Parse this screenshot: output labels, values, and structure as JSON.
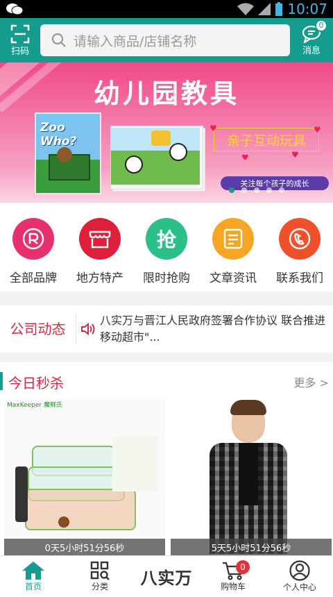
{
  "status_bar": {
    "time": "10:07"
  },
  "header": {
    "scan_label": "扫码",
    "search": {
      "placeholder": "请输入商品/店铺名称"
    },
    "messages": {
      "label": "消息",
      "badge": "0"
    }
  },
  "banner": {
    "title": "幼儿园教具",
    "book_logo": "Zoo Who?",
    "tagline": "亲子互动玩具",
    "subline": "关注每个孩子的成长",
    "slide_count": 5,
    "active_slide": 1
  },
  "shortcuts": [
    {
      "label": "全部品牌",
      "icon": "registered-icon",
      "color": "#e8306e",
      "glyph": "®"
    },
    {
      "label": "地方特产",
      "icon": "store-icon",
      "color": "#e0203a",
      "glyph": "⌂"
    },
    {
      "label": "限时抢购",
      "icon": "grab-icon",
      "color": "#2bc08a",
      "glyph": "抢"
    },
    {
      "label": "文章资讯",
      "icon": "article-icon",
      "color": "#f6a623",
      "glyph": "≡"
    },
    {
      "label": "联系我们",
      "icon": "phone-icon",
      "color": "#f0502a",
      "glyph": "✆"
    }
  ],
  "news": {
    "label": "公司动态",
    "headline": "八实万与晋江人民政府签署合作协议 联合推进移动超市\"..."
  },
  "flash_sale": {
    "title": "今日秒杀",
    "more": "更多 >",
    "products": [
      {
        "brand": "MaxKeeper 魔鲜氏",
        "timer": "0天5小时51分56秒"
      },
      {
        "timer": "5天5小时51分56秒"
      }
    ]
  },
  "bottom_nav": {
    "items": [
      {
        "label": "首页",
        "icon": "home-icon",
        "active": true
      },
      {
        "label": "分类",
        "icon": "grid-icon",
        "active": false
      },
      {
        "label": "八实万",
        "icon": "brand-logo",
        "active": false
      },
      {
        "label": "购物车",
        "icon": "cart-icon",
        "active": false,
        "badge": "0"
      },
      {
        "label": "个人中心",
        "icon": "user-icon",
        "active": false
      }
    ]
  },
  "colors": {
    "primary": "#159c8e",
    "accent_red": "#d8273f",
    "banner_pink": "#f04a86"
  }
}
